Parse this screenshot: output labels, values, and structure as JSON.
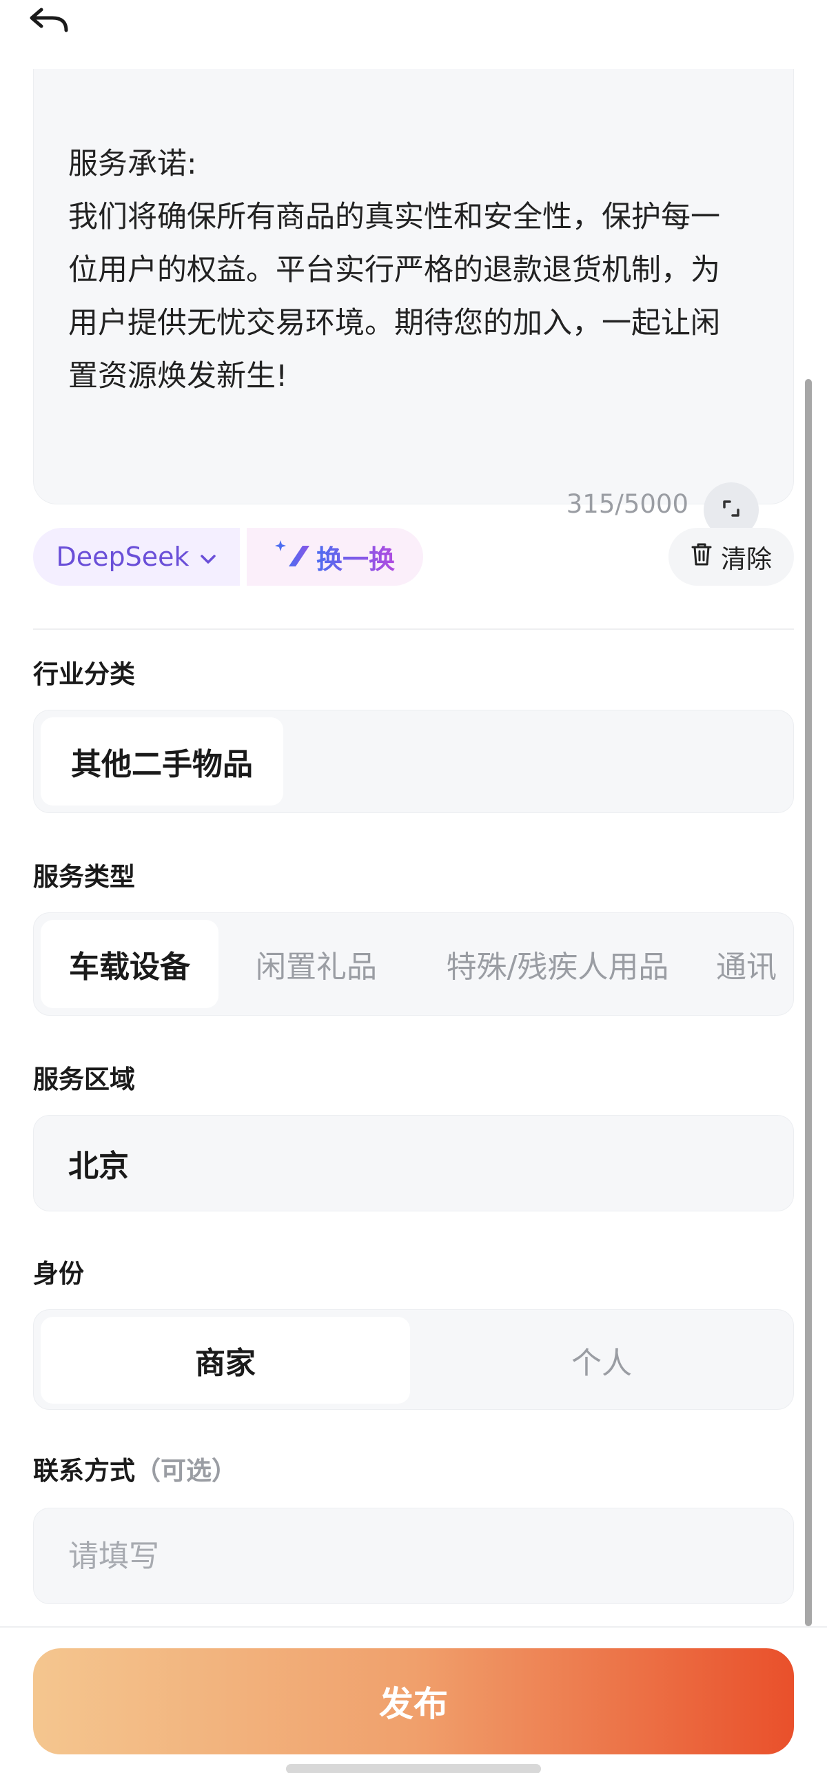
{
  "description": {
    "lines": [
      "服务承诺:",
      "我们将确保所有商品的真实性和安全性，保护每一",
      "位用户的权益。平台实行严格的退款退货机制，为",
      "用户提供无忧交易环境。期待您的加入，一起让闲",
      "置资源焕发新生!"
    ],
    "counter": "315/5000"
  },
  "toolbar": {
    "model_label": "DeepSeek",
    "swap_label": "换一换",
    "clear_label": "清除"
  },
  "industry": {
    "title": "行业分类",
    "selected": "其他二手物品"
  },
  "service_type": {
    "title": "服务类型",
    "options": [
      "车载设备",
      "闲置礼品",
      "特殊/残疾人用品",
      "通讯"
    ],
    "selected_index": 0
  },
  "service_area": {
    "title": "服务区域",
    "value": "北京"
  },
  "identity": {
    "title": "身份",
    "options": [
      "商家",
      "个人"
    ],
    "selected_index": 0
  },
  "contact": {
    "title": "联系方式",
    "optional": "（可选）",
    "placeholder": "请填写"
  },
  "publish_label": "发布",
  "colors": {
    "accent_start": "#f4c68f",
    "accent_end": "#e9502b",
    "model_text": "#6a4fd8"
  }
}
